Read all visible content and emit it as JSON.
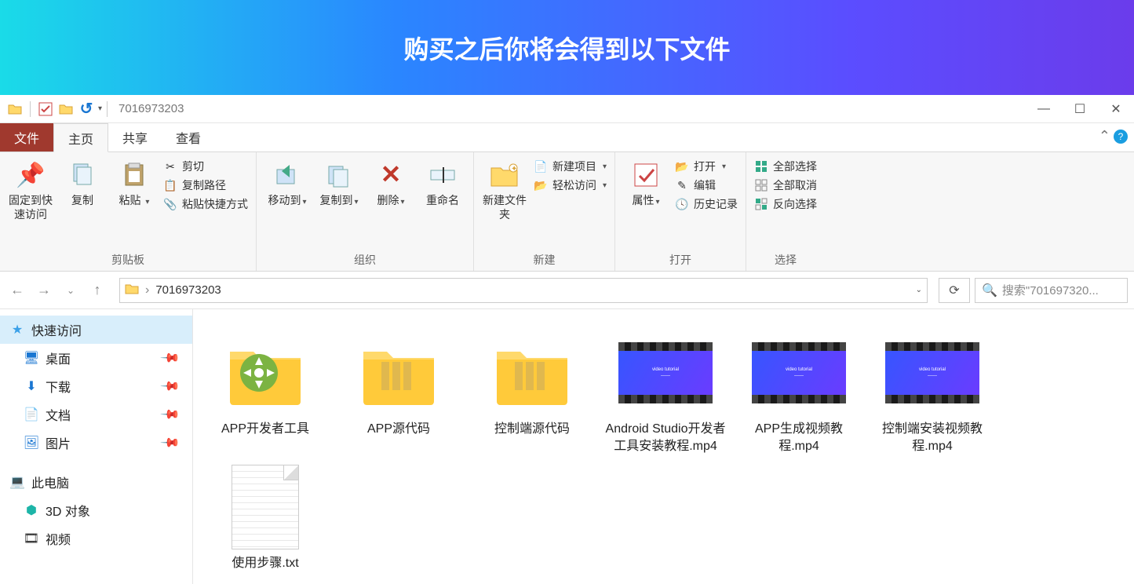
{
  "banner": {
    "title": "购买之后你将会得到以下文件"
  },
  "titlebar": {
    "folder_name": "7016973203"
  },
  "tabs": {
    "file": "文件",
    "home": "主页",
    "share": "共享",
    "view": "查看"
  },
  "ribbon": {
    "clipboard": {
      "pin": "固定到快速访问",
      "copy": "复制",
      "paste": "粘贴",
      "cut": "剪切",
      "copy_path": "复制路径",
      "paste_shortcut": "粘贴快捷方式",
      "label": "剪贴板"
    },
    "organize": {
      "move_to": "移动到",
      "copy_to": "复制到",
      "delete": "删除",
      "rename": "重命名",
      "label": "组织"
    },
    "new": {
      "new_folder": "新建文件夹",
      "new_item": "新建项目",
      "easy_access": "轻松访问",
      "label": "新建"
    },
    "open": {
      "properties": "属性",
      "open": "打开",
      "edit": "编辑",
      "history": "历史记录",
      "label": "打开"
    },
    "select": {
      "select_all": "全部选择",
      "select_none": "全部取消",
      "invert": "反向选择",
      "label": "选择"
    }
  },
  "nav": {
    "crumb": "7016973203",
    "search_placeholder": "搜索\"701697320..."
  },
  "sidebar": {
    "quick": "快速访问",
    "desktop": "桌面",
    "downloads": "下载",
    "documents": "文档",
    "pictures": "图片",
    "this_pc": "此电脑",
    "objects_3d": "3D 对象",
    "videos": "视频"
  },
  "files": [
    {
      "type": "folder-app",
      "name": "APP开发者工具"
    },
    {
      "type": "folder",
      "name": "APP源代码"
    },
    {
      "type": "folder",
      "name": "控制端源代码"
    },
    {
      "type": "video",
      "name": "Android Studio开发者工具安装教程.mp4"
    },
    {
      "type": "video",
      "name": "APP生成视频教程.mp4"
    },
    {
      "type": "video",
      "name": "控制端安装视频教程.mp4"
    },
    {
      "type": "txt",
      "name": "使用步骤.txt"
    }
  ]
}
